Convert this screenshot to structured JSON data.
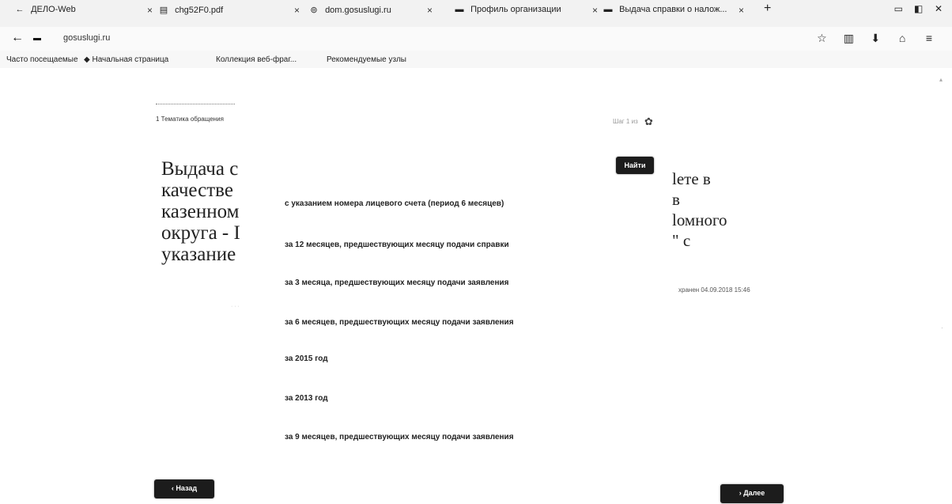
{
  "browser": {
    "tabs": [
      {
        "icon": "←",
        "title": "ДЕЛО-Web"
      },
      {
        "icon": "×",
        "title": "chg52F0.pdf"
      },
      {
        "icon": "⊚",
        "title": "dom.gosuslugi.ru"
      },
      {
        "icon": "▬",
        "title": "Профиль организации"
      },
      {
        "icon": "▬",
        "title": "Выдача справки о налож..."
      }
    ],
    "tab_close": "×",
    "new_tab": "+",
    "window_controls": [
      "▭",
      "◧",
      "✕"
    ],
    "url": "gosuslugi.ru",
    "back": "←",
    "bookmarks": [
      "Часто посещаемые",
      "Начальная страница",
      "Коллекция веб-фраг...",
      "Рекомендуемые узлы"
    ]
  },
  "page": {
    "step_label": "1 Тематика обращения",
    "step_right": "Шаг 1 из",
    "title_left": [
      "Выдача с",
      "качестве",
      "казенном",
      "округа - I",
      "указание"
    ],
    "title_right": [
      "lете в",
      "в",
      "lомного",
      "\" с"
    ],
    "saved_text": "хранен 04.09.2018 15:46",
    "find_button": "Найти",
    "back_button": "‹ Назад",
    "next_button": "› Далее"
  },
  "dropdown": {
    "options": [
      "с указанием номера лицевого счета (период 6 месяцев)",
      "за 12 месяцев, предшествующих месяцу подачи справки",
      "за 3 месяца, предшествующих месяцу подачи заявления",
      "за 6 месяцев, предшествующих месяцу подачи заявления",
      "за 2015 год",
      "за 2013 год",
      "за 9 месяцев, предшествующих месяцу подачи заявления"
    ]
  }
}
